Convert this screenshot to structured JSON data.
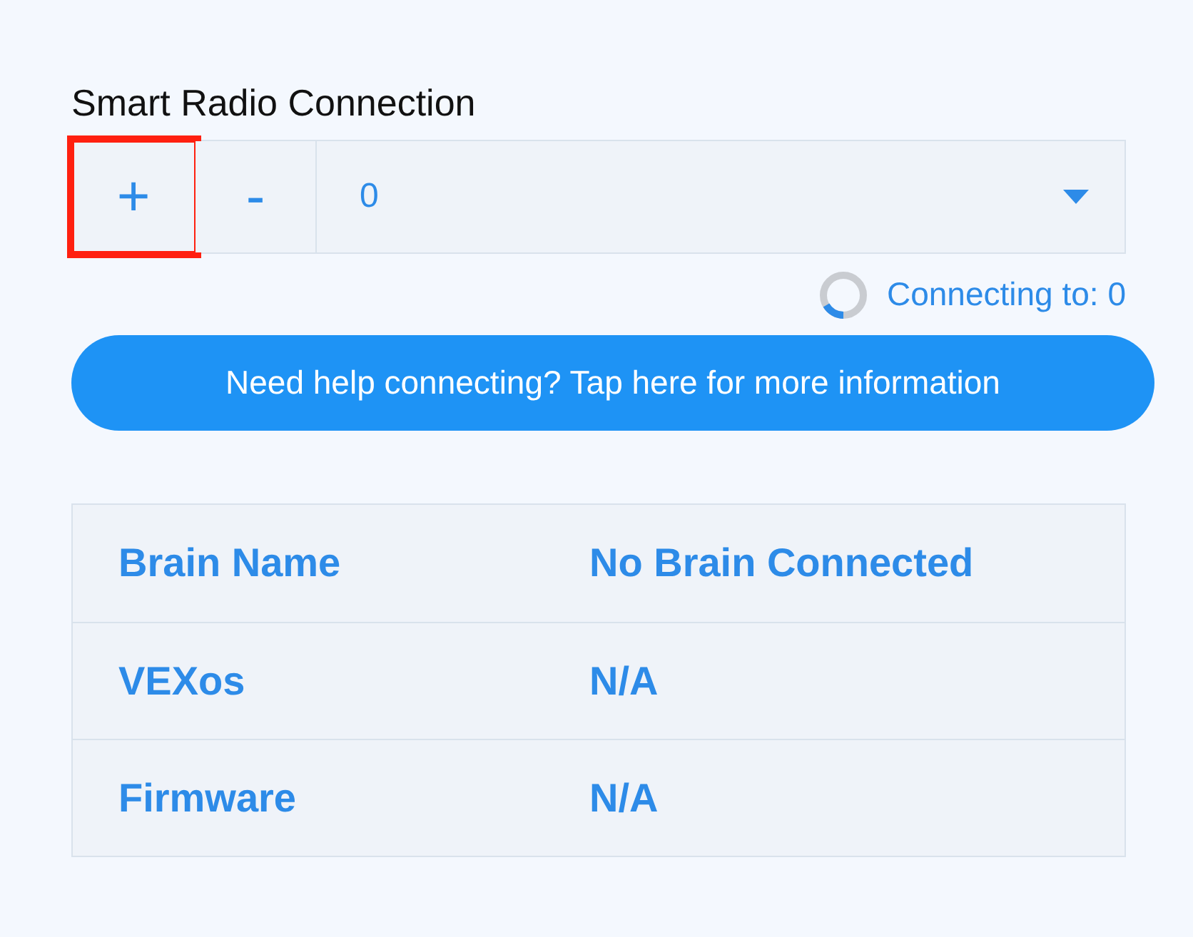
{
  "title": "Smart Radio Connection",
  "controls": {
    "add": {
      "label": "+",
      "highlighted": true
    },
    "remove": {
      "label": "-",
      "highlighted": false
    },
    "select": {
      "value": "0"
    }
  },
  "status": {
    "text": "Connecting to: 0",
    "busy": true
  },
  "help_button": "Need help connecting? Tap here for more information",
  "table": {
    "rows": [
      {
        "label": "Brain Name",
        "value": "No Brain Connected"
      },
      {
        "label": "VEXos",
        "value": "N/A"
      },
      {
        "label": "Firmware",
        "value": "N/A"
      }
    ]
  }
}
